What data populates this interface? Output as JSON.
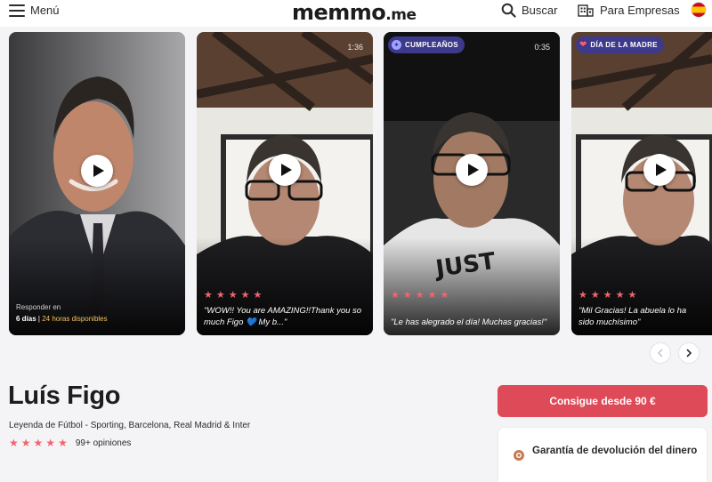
{
  "header": {
    "menu_label": "Menú",
    "logo_main": "memmo",
    "logo_tld": ".me",
    "search_label": "Buscar",
    "business_label": "Para Empresas",
    "language_icon": "spain-flag-icon"
  },
  "cards": [
    {
      "respond_label": "Responder en",
      "respond_days": "6 días",
      "respond_avail": "24 horas disponibles"
    },
    {
      "duration": "1:36",
      "quote": "\"WOW!! You are AMAZING!!Thank you so much Figo 💙 My b...\"",
      "stars": 5
    },
    {
      "tag": "CUMPLEAÑOS",
      "duration": "0:35",
      "quote": "\"Le has alegrado el día! Muchas gracias!\"",
      "stars": 5
    },
    {
      "tag": "DÍA DE LA MADRE",
      "quote": "\"Mil Gracias! La abuela lo ha sido muchísimo\"",
      "stars": 5
    }
  ],
  "profile": {
    "name": "Luís Figo",
    "subtitle": "Leyenda de Fútbol - Sporting, Barcelona, Real Madrid & Inter",
    "rating_stars": 5,
    "opinions": "99+ opiniones"
  },
  "cta": {
    "label": "Consigue desde 90 €"
  },
  "guarantee": {
    "text": "Garantía de devolución del dinero"
  },
  "colors": {
    "accent": "#de4a57",
    "star": "#f26470",
    "tag_bg": "#3d3a8c",
    "availability": "#f4c15a"
  }
}
